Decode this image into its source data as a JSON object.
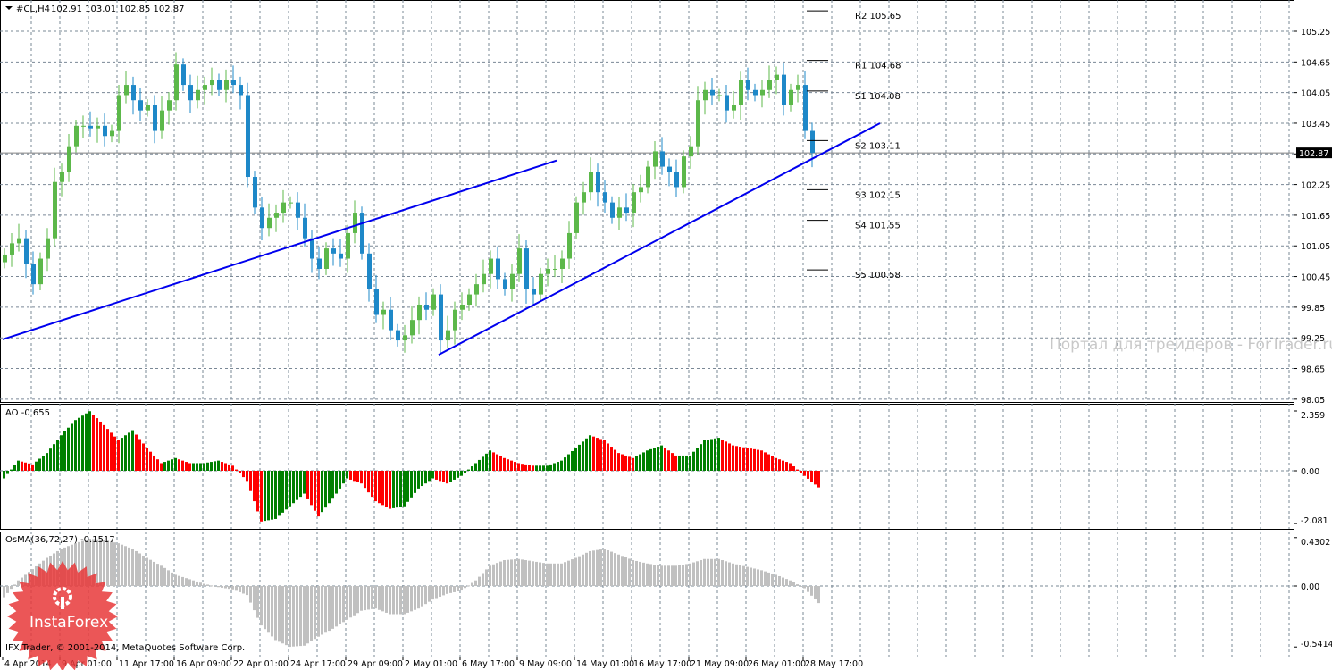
{
  "header": {
    "symbol": "#CL,H4",
    "ohlc": "102.91 103.01 102.85 102.87"
  },
  "colors": {
    "bull": "#5cb84a",
    "bear": "#1e88c8",
    "trendline": "#0000ee",
    "ao_up": "#008000",
    "ao_down": "#ff0000",
    "osma": "#c0c0c0",
    "grid": "#7a8896",
    "price_box": "#000000"
  },
  "chart_data": [
    {
      "type": "candlestick",
      "title": "#CL,H4",
      "current_price": 102.87,
      "current_price_label": "102.87",
      "ylim": [
        98.05,
        105.65
      ],
      "yticks": [
        "105.25",
        "104.65",
        "104.05",
        "103.45",
        "102.25",
        "101.65",
        "101.05",
        "100.45",
        "99.85",
        "99.25",
        "98.65",
        "98.05"
      ],
      "grid": true,
      "closes": [
        100.88,
        101.1,
        101.2,
        100.7,
        100.3,
        100.8,
        101.2,
        102.3,
        102.5,
        103.0,
        103.4,
        103.4,
        103.35,
        103.4,
        103.2,
        103.3,
        104.0,
        104.2,
        103.9,
        103.7,
        103.8,
        103.3,
        103.7,
        103.9,
        104.6,
        104.2,
        103.9,
        104.1,
        104.2,
        104.3,
        104.1,
        104.3,
        104.2,
        104.0,
        102.4,
        101.8,
        101.4,
        101.6,
        101.7,
        101.9,
        101.9,
        101.6,
        101.2,
        100.8,
        100.6,
        101.0,
        100.9,
        100.8,
        101.3,
        101.7,
        100.9,
        100.2,
        99.7,
        99.8,
        99.4,
        99.2,
        99.3,
        99.6,
        99.9,
        99.8,
        100.1,
        99.2,
        99.4,
        99.8,
        99.9,
        100.1,
        100.3,
        100.5,
        100.8,
        100.4,
        100.2,
        100.5,
        101.0,
        100.2,
        100.1,
        100.5,
        100.6,
        100.6,
        100.8,
        101.3,
        101.9,
        102.1,
        102.5,
        102.1,
        101.9,
        101.6,
        101.8,
        101.7,
        102.1,
        102.2,
        102.6,
        102.9,
        102.6,
        102.5,
        102.2,
        102.8,
        103.0,
        103.9,
        104.1,
        104.0,
        104.0,
        103.7,
        103.8,
        104.3,
        104.1,
        104.0,
        104.1,
        104.3,
        104.4,
        103.8,
        104.1,
        104.2,
        103.3,
        102.87
      ],
      "trendlines": [
        {
          "from": {
            "bar": 0,
            "price": 99.22
          },
          "to": {
            "bar": 155,
            "price": 102.72
          }
        },
        {
          "from": {
            "bar": 122,
            "price": 98.92
          },
          "to": {
            "bar": 245.5,
            "price": 103.45
          }
        }
      ],
      "pivots": [
        {
          "label": "R2 105.65",
          "price": 105.65
        },
        {
          "label": "R1 104.68",
          "price": 104.68
        },
        {
          "label": "S1 104.08",
          "price": 104.08
        },
        {
          "label": "S2 103.11",
          "price": 103.11
        },
        {
          "label": "S3 102.15",
          "price": 102.15
        },
        {
          "label": "S4 101.55",
          "price": 101.55
        },
        {
          "label": "S5 100.58",
          "price": 100.58
        }
      ]
    },
    {
      "type": "bar",
      "title": "AO -0.655",
      "ylim": [
        -2.081,
        2.359
      ],
      "yticks": [
        "2.359",
        "0.00",
        "-2.081"
      ],
      "values": [
        -0.3,
        0.4,
        0.25,
        0.7,
        1.4,
        2.0,
        2.35,
        1.8,
        1.2,
        1.6,
        0.9,
        0.3,
        0.5,
        0.3,
        0.3,
        0.4,
        0.2,
        -0.4,
        -2.0,
        -1.9,
        -1.4,
        -0.9,
        -1.8,
        -1.1,
        -0.3,
        -0.5,
        -1.2,
        -1.5,
        -1.4,
        -0.7,
        -0.3,
        -0.5,
        -0.2,
        0.3,
        0.8,
        0.5,
        0.3,
        0.2,
        0.2,
        0.4,
        0.9,
        1.4,
        1.2,
        0.7,
        0.5,
        0.8,
        1.0,
        0.6,
        0.6,
        1.2,
        1.3,
        1.0,
        0.9,
        0.8,
        0.5,
        0.3,
        -0.2,
        -0.655
      ]
    },
    {
      "type": "bar",
      "title": "OsMA(36,72,27) -0.1517",
      "ylim": [
        -0.5414,
        0.4302
      ],
      "yticks": [
        "0.4302",
        "0.00",
        "-0.5414"
      ],
      "values": [
        -0.1,
        0.05,
        0.15,
        0.25,
        0.33,
        0.38,
        0.42,
        0.41,
        0.38,
        0.33,
        0.25,
        0.18,
        0.1,
        0.06,
        0.02,
        -0.01,
        -0.03,
        -0.08,
        -0.35,
        -0.48,
        -0.54,
        -0.53,
        -0.45,
        -0.38,
        -0.3,
        -0.22,
        -0.2,
        -0.25,
        -0.25,
        -0.2,
        -0.12,
        -0.07,
        -0.04,
        0.05,
        0.18,
        0.23,
        0.24,
        0.22,
        0.2,
        0.2,
        0.25,
        0.31,
        0.33,
        0.28,
        0.23,
        0.2,
        0.18,
        0.18,
        0.2,
        0.24,
        0.24,
        0.2,
        0.17,
        0.14,
        0.1,
        0.05,
        -0.02,
        -0.1517
      ]
    }
  ],
  "xticks": [
    "4 Apr 2014",
    "9 Apr 01:00",
    "11 Apr 17:00",
    "16 Apr 09:00",
    "22 Apr 01:00",
    "24 Apr 17:00",
    "29 Apr 09:00",
    "2 May 01:00",
    "6 May 17:00",
    "9 May 09:00",
    "14 May 01:00",
    "16 May 17:00",
    "21 May 09:00",
    "26 May 01:00",
    "28 May 17:00"
  ],
  "watermark": "Портал для трейдеров - ForTrader.ru",
  "logo": "InstaForex",
  "copyright": "IFX Trader, © 2001-2014, MetaQuotes Software Corp."
}
